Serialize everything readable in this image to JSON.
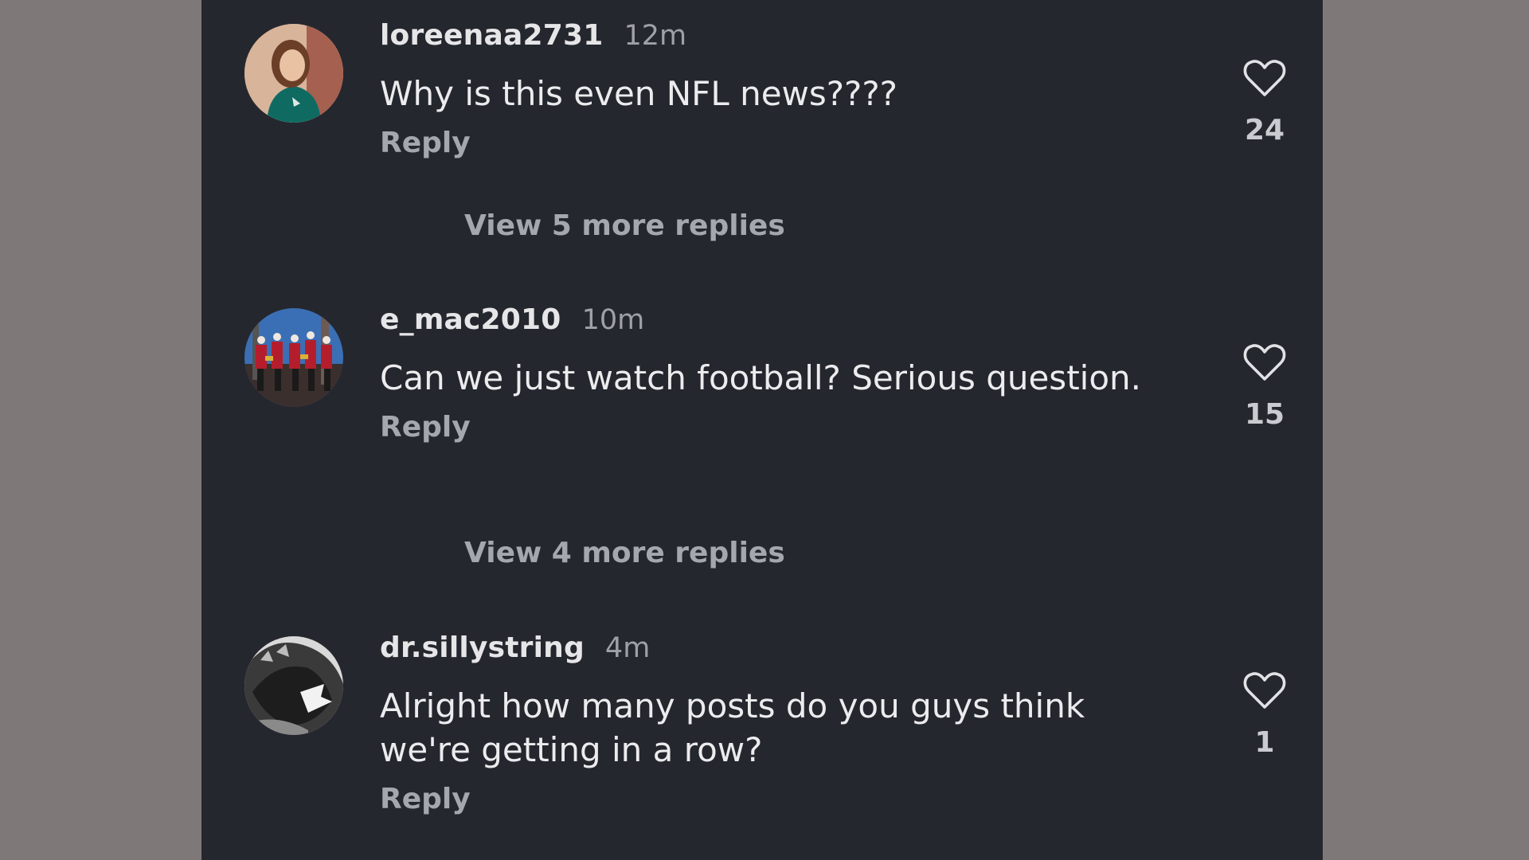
{
  "comments": [
    {
      "username": "loreenaa2731",
      "time": "12m",
      "text": "Why is this even NFL news????",
      "reply_label": "Reply",
      "likes": "24",
      "view_more": "View 5 more replies"
    },
    {
      "username": "e_mac2010",
      "time": "10m",
      "text": "Can we just watch football? Serious question.",
      "reply_label": "Reply",
      "likes": "15",
      "view_more": "View 4 more replies"
    },
    {
      "username": "dr.sillystring",
      "time": "4m",
      "text": "Alright how many posts do you guys think we're getting in a row?",
      "reply_label": "Reply",
      "likes": "1"
    }
  ],
  "icons": {
    "like": "heart-outline-icon"
  },
  "colors": {
    "background": "#25272e",
    "side_background": "#7f7878",
    "text_primary": "#ececee",
    "text_secondary": "#a5a7ae"
  }
}
